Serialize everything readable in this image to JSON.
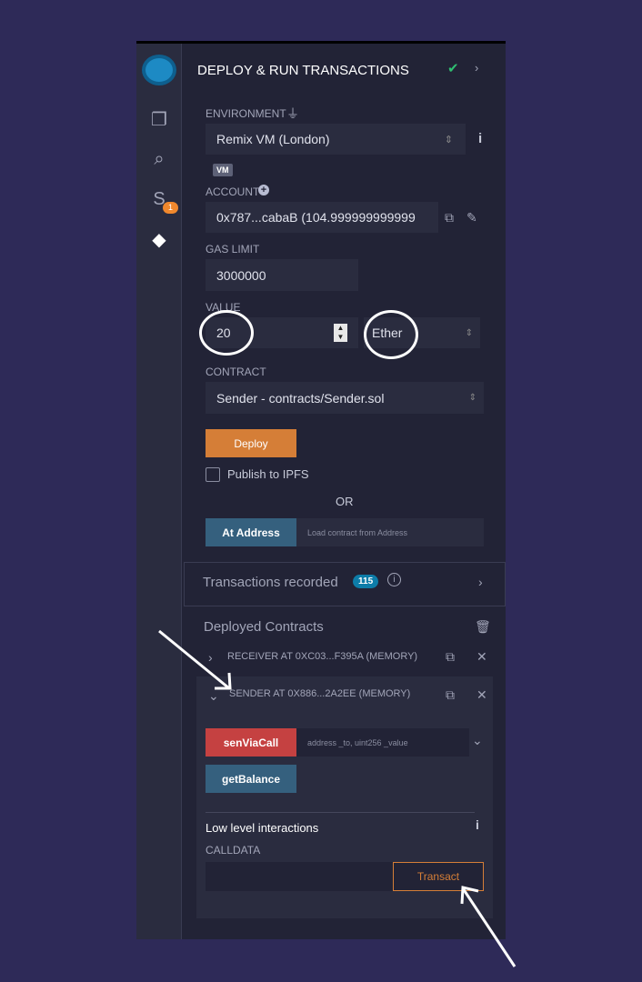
{
  "header": {
    "title": "DEPLOY & RUN TRANSACTIONS"
  },
  "environment": {
    "label": "ENVIRONMENT",
    "value": "Remix VM (London)",
    "badge": "VM"
  },
  "account": {
    "label": "ACCOUNT",
    "value": "0x787...cabaB (104.999999999999"
  },
  "gas_limit": {
    "label": "GAS LIMIT",
    "value": "3000000"
  },
  "value": {
    "label": "VALUE",
    "amount": "20",
    "unit": "Ether"
  },
  "contract": {
    "label": "CONTRACT",
    "value": "Sender - contracts/Sender.sol"
  },
  "deploy": {
    "label": "Deploy",
    "publish": "Publish to IPFS",
    "or": "OR",
    "at_address": "At Address",
    "at_address_placeholder": "Load contract from Address"
  },
  "transactions": {
    "label": "Transactions recorded",
    "count": "115"
  },
  "deployed": {
    "title": "Deployed Contracts",
    "items": [
      {
        "label": "RECEIVER AT 0XC03...F395A (MEMORY)"
      },
      {
        "label": "SENDER AT 0X886...2A2EE (MEMORY)"
      }
    ]
  },
  "functions": {
    "send": "senViaCall",
    "send_placeholder": "address _to, uint256 _value",
    "balance": "getBalance"
  },
  "low_level": {
    "title": "Low level interactions",
    "calldata": "CALLDATA",
    "transact": "Transact"
  },
  "sidebar": {
    "badge": "1"
  },
  "colors": {
    "background": "#2e2a58",
    "deploy": "#d57e37",
    "call": "#c54141",
    "view": "#35607e",
    "badge": "#0d7ca8",
    "check": "#2fbf71"
  }
}
